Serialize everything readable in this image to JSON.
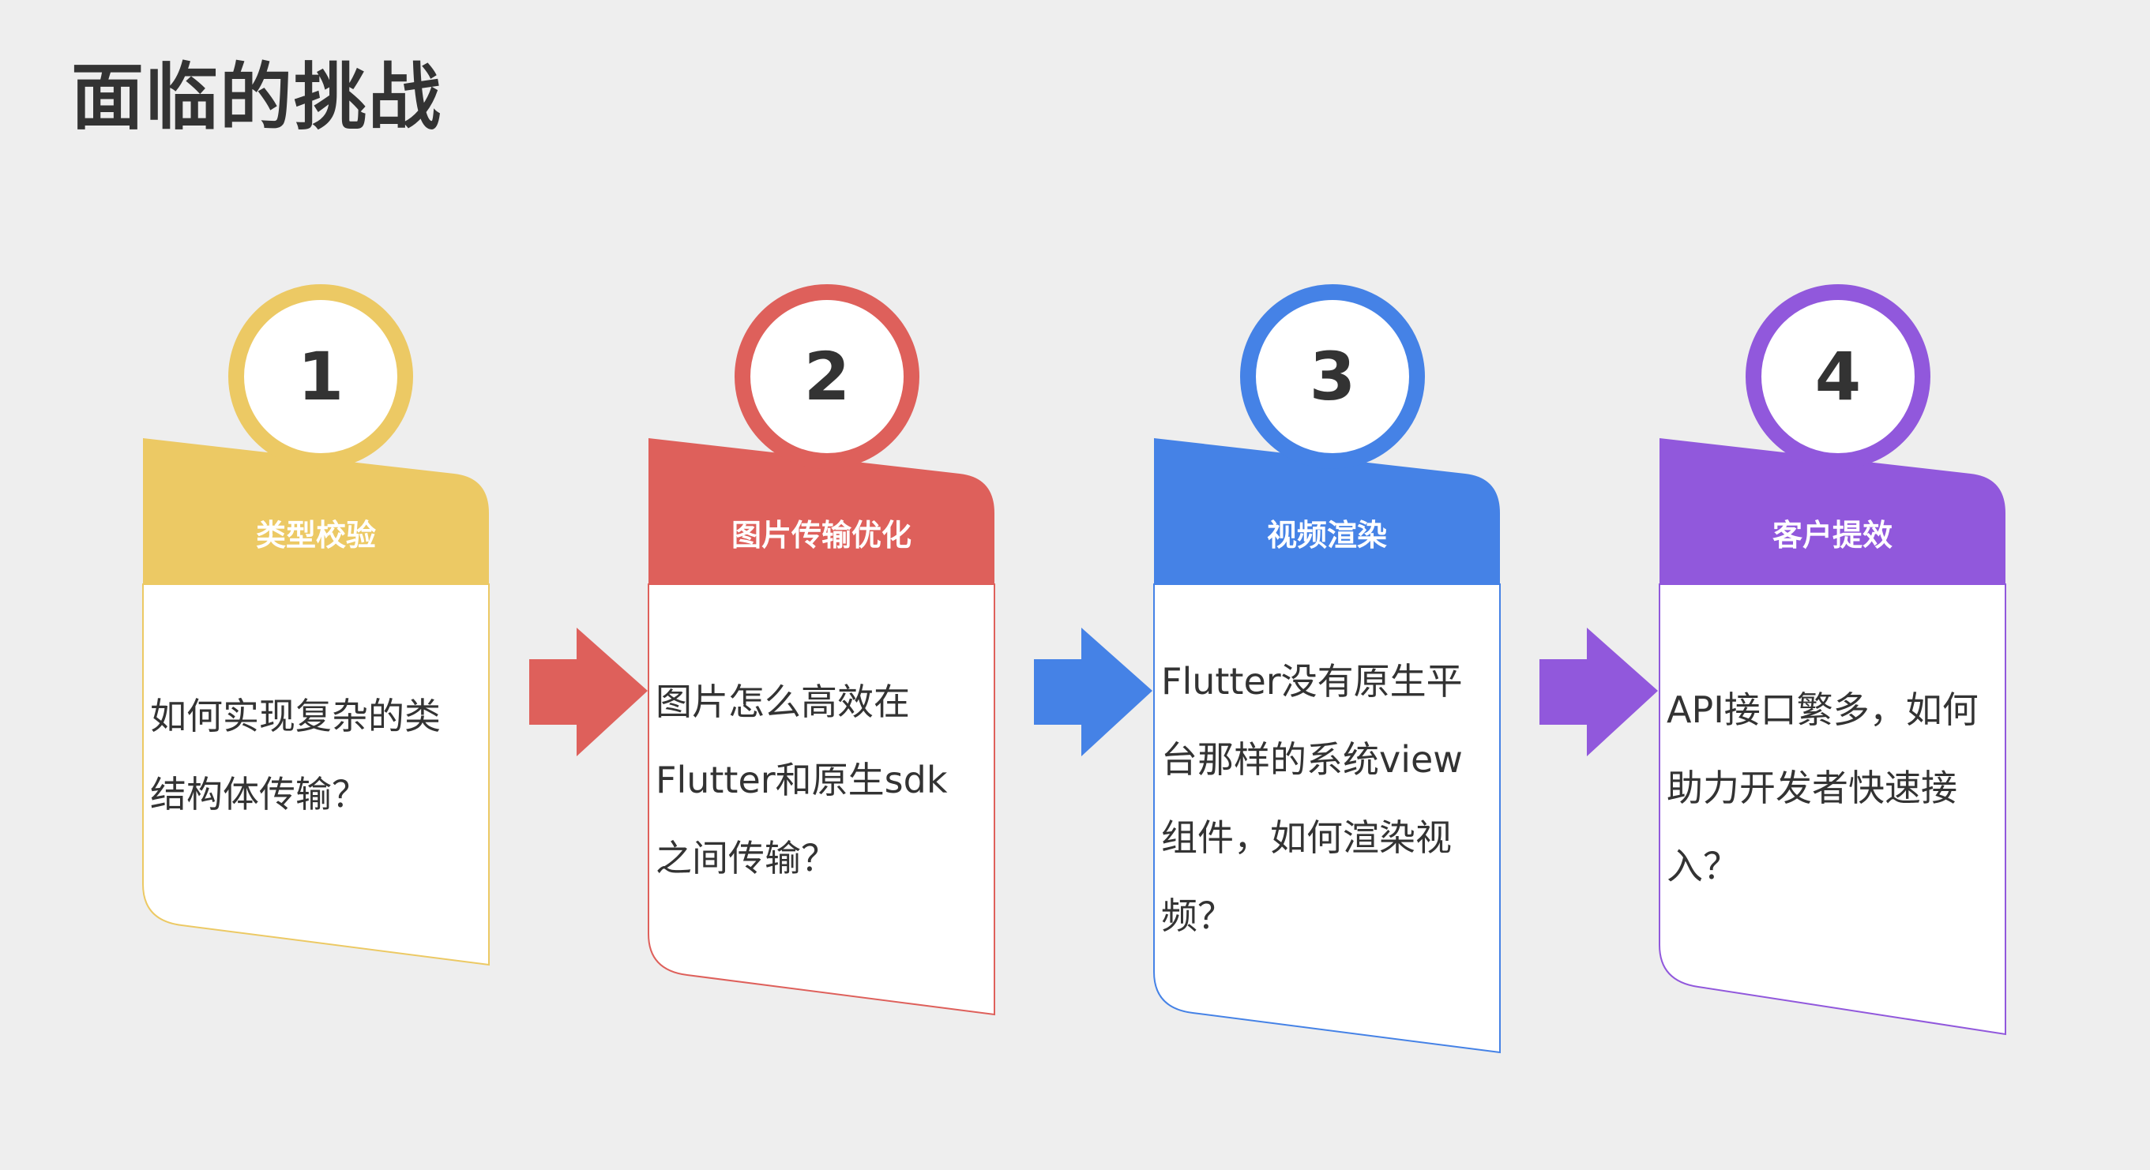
{
  "page_title": "面临的挑战",
  "steps": [
    {
      "number": "1",
      "title": "类型校验",
      "text": "如何实现复杂的类\n结构体传输？",
      "color": "#ecc964"
    },
    {
      "number": "2",
      "title": "图片传输优化",
      "text": "图片怎么高效在\nFlutter和原生sdk\n之间传输？",
      "color": "#de605b"
    },
    {
      "number": "3",
      "title": "视频渲染",
      "text": "Flutter没有原生平\n台那样的系统view\n组件，如何渲染视\n频？",
      "color": "#4582e6"
    },
    {
      "number": "4",
      "title": "客户提效",
      "text": "API接口繁多，如何\n助力开发者快速接\n入？",
      "color": "#9158dc"
    }
  ]
}
